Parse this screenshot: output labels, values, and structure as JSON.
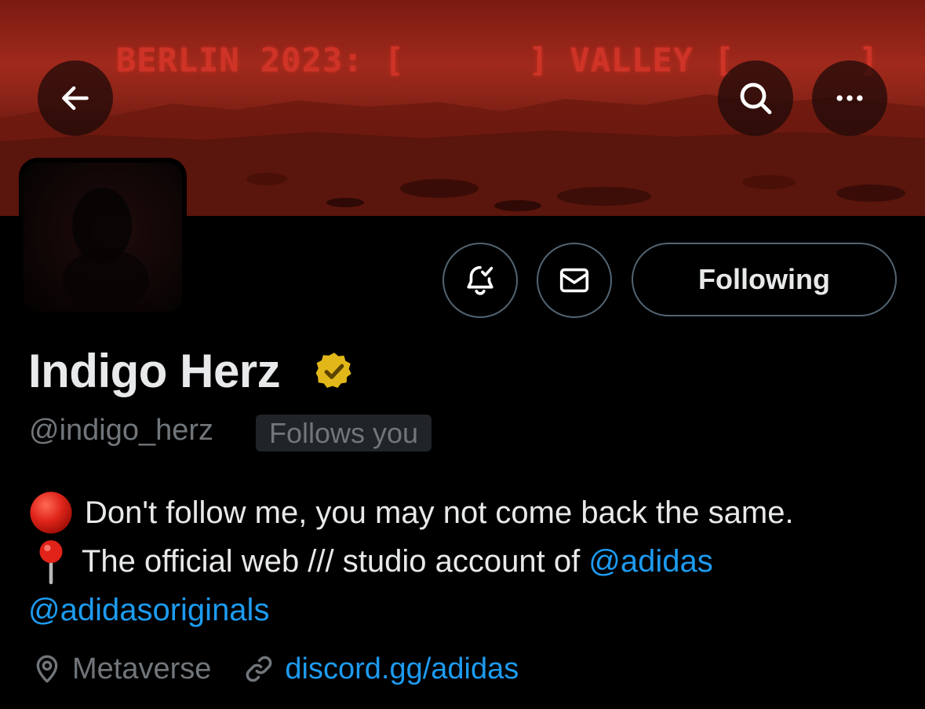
{
  "banner": {
    "text": "BERLIN 2023: [      ] VALLEY [      ]"
  },
  "header": {
    "back_icon": "arrow-left-icon",
    "search_icon": "search-icon",
    "more_icon": "more-horizontal-icon"
  },
  "actions": {
    "notifications_icon": "bell-check-icon",
    "message_icon": "mail-icon",
    "following_label": "Following"
  },
  "profile": {
    "name": "Indigo Herz",
    "verified_icon": "verified-badge-icon",
    "verified_color": "#e2b719",
    "handle": "@indigo_herz",
    "follows_you": "Follows you",
    "bio_line1": "Don't follow me, you may not come back the same.",
    "bio_line2_text": "The official web /// studio account of ",
    "bio_mention1": "@adidas",
    "bio_mention2": "@adidasoriginals",
    "location": "Metaverse",
    "link": "discord.gg/adidas"
  },
  "colors": {
    "accent": "#1d9bf0",
    "muted": "#71767b",
    "border": "#536471",
    "text": "#e7e9ea"
  }
}
